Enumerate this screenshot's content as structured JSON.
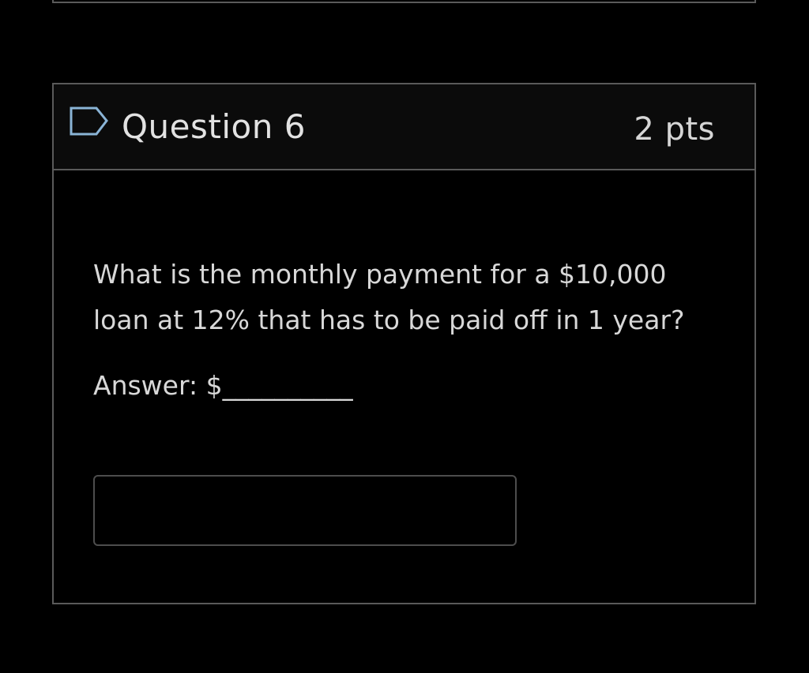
{
  "question": {
    "title": "Question 6",
    "points": "2 pts",
    "flag_icon": "flag-icon",
    "text": "What is the monthly payment for a $10,000 loan at 12% that has to be paid off in 1 year?",
    "answer_prompt": "Answer: $__________",
    "answer_value": ""
  },
  "colors": {
    "background": "#000000",
    "header_background": "#0b0b0b",
    "border": "#5a5a5a",
    "text": "#d8d8d8",
    "flag_outline": "#8ab4d6"
  }
}
